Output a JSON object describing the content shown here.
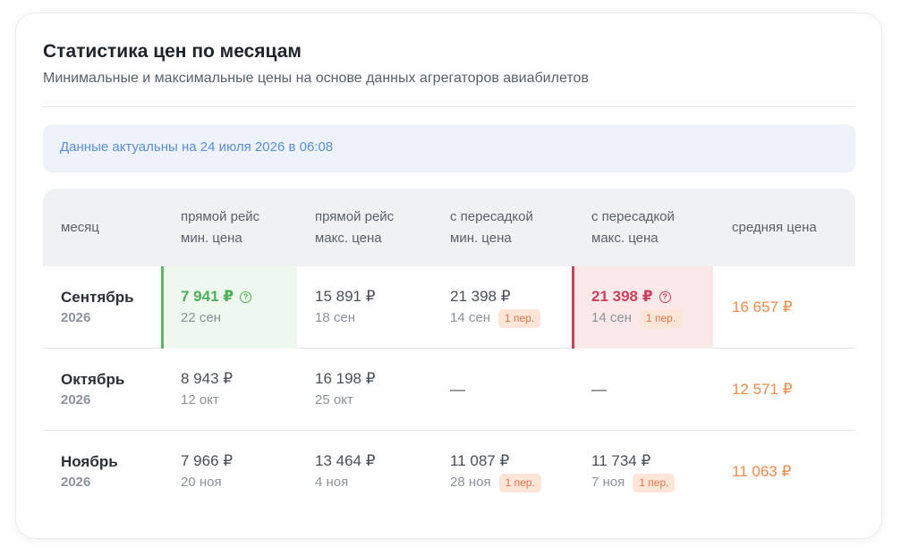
{
  "header": {
    "title": "Статистика цен по месяцам",
    "subtitle": "Минимальные и максимальные цены на основе данных агрегаторов авиабилетов"
  },
  "notice": {
    "text": "Данные актуальны на 24 июля 2026 в 06:08"
  },
  "table": {
    "columns": [
      {
        "line1": "месяц",
        "line2": ""
      },
      {
        "line1": "прямой рейс",
        "line2": "мин. цена"
      },
      {
        "line1": "прямой рейс",
        "line2": "макс. цена"
      },
      {
        "line1": "с пересадкой",
        "line2": "мин. цена"
      },
      {
        "line1": "с пересадкой",
        "line2": "макс. цена"
      },
      {
        "line1": "средняя цена",
        "line2": ""
      }
    ],
    "rows": [
      {
        "month": "Сентябрь",
        "year": "2026",
        "direct_min": {
          "price": "7 941 ₽",
          "date": "22 сен"
        },
        "direct_max": {
          "price": "15 891 ₽",
          "date": "18 сен"
        },
        "transfer_min": {
          "price": "21 398 ₽",
          "date": "14 сен",
          "badge": "1 пер."
        },
        "transfer_max": {
          "price": "21 398 ₽",
          "date": "14 сен",
          "badge": "1 пер."
        },
        "avg": "16 657 ₽"
      },
      {
        "month": "Октябрь",
        "year": "2026",
        "direct_min": {
          "price": "8 943 ₽",
          "date": "12 окт"
        },
        "direct_max": {
          "price": "16 198 ₽",
          "date": "25 окт"
        },
        "transfer_min": {
          "dash": "—"
        },
        "transfer_max": {
          "dash": "—"
        },
        "avg": "12 571 ₽"
      },
      {
        "month": "Ноябрь",
        "year": "2026",
        "direct_min": {
          "price": "7 966 ₽",
          "date": "20 ноя"
        },
        "direct_max": {
          "price": "13 464 ₽",
          "date": "4 ноя"
        },
        "transfer_min": {
          "price": "11 087 ₽",
          "date": "28 ноя",
          "badge": "1 пер."
        },
        "transfer_max": {
          "price": "11 734 ₽",
          "date": "7 ноя",
          "badge": "1 пер."
        },
        "avg": "11 063 ₽"
      }
    ],
    "help_icon": "?"
  },
  "colors": {
    "lowest": "#4fae58",
    "highest": "#c9425c",
    "average": "#ef8a4a",
    "notice_text": "#5b8fd6"
  },
  "icons": {
    "help": "question-circle-icon"
  }
}
